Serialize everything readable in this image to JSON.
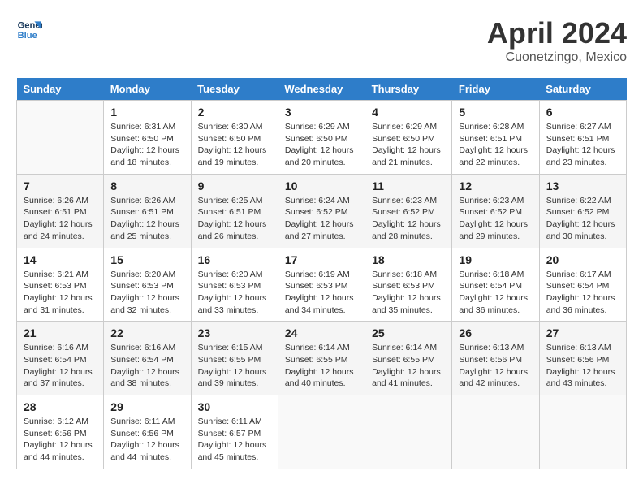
{
  "header": {
    "logo_line1": "General",
    "logo_line2": "Blue",
    "month": "April 2024",
    "location": "Cuonetzingo, Mexico"
  },
  "columns": [
    "Sunday",
    "Monday",
    "Tuesday",
    "Wednesday",
    "Thursday",
    "Friday",
    "Saturday"
  ],
  "weeks": [
    [
      {
        "day": "",
        "empty": true
      },
      {
        "day": "1",
        "sunrise": "Sunrise: 6:31 AM",
        "sunset": "Sunset: 6:50 PM",
        "daylight": "Daylight: 12 hours and 18 minutes."
      },
      {
        "day": "2",
        "sunrise": "Sunrise: 6:30 AM",
        "sunset": "Sunset: 6:50 PM",
        "daylight": "Daylight: 12 hours and 19 minutes."
      },
      {
        "day": "3",
        "sunrise": "Sunrise: 6:29 AM",
        "sunset": "Sunset: 6:50 PM",
        "daylight": "Daylight: 12 hours and 20 minutes."
      },
      {
        "day": "4",
        "sunrise": "Sunrise: 6:29 AM",
        "sunset": "Sunset: 6:50 PM",
        "daylight": "Daylight: 12 hours and 21 minutes."
      },
      {
        "day": "5",
        "sunrise": "Sunrise: 6:28 AM",
        "sunset": "Sunset: 6:51 PM",
        "daylight": "Daylight: 12 hours and 22 minutes."
      },
      {
        "day": "6",
        "sunrise": "Sunrise: 6:27 AM",
        "sunset": "Sunset: 6:51 PM",
        "daylight": "Daylight: 12 hours and 23 minutes."
      }
    ],
    [
      {
        "day": "7",
        "sunrise": "Sunrise: 6:26 AM",
        "sunset": "Sunset: 6:51 PM",
        "daylight": "Daylight: 12 hours and 24 minutes."
      },
      {
        "day": "8",
        "sunrise": "Sunrise: 6:26 AM",
        "sunset": "Sunset: 6:51 PM",
        "daylight": "Daylight: 12 hours and 25 minutes."
      },
      {
        "day": "9",
        "sunrise": "Sunrise: 6:25 AM",
        "sunset": "Sunset: 6:51 PM",
        "daylight": "Daylight: 12 hours and 26 minutes."
      },
      {
        "day": "10",
        "sunrise": "Sunrise: 6:24 AM",
        "sunset": "Sunset: 6:52 PM",
        "daylight": "Daylight: 12 hours and 27 minutes."
      },
      {
        "day": "11",
        "sunrise": "Sunrise: 6:23 AM",
        "sunset": "Sunset: 6:52 PM",
        "daylight": "Daylight: 12 hours and 28 minutes."
      },
      {
        "day": "12",
        "sunrise": "Sunrise: 6:23 AM",
        "sunset": "Sunset: 6:52 PM",
        "daylight": "Daylight: 12 hours and 29 minutes."
      },
      {
        "day": "13",
        "sunrise": "Sunrise: 6:22 AM",
        "sunset": "Sunset: 6:52 PM",
        "daylight": "Daylight: 12 hours and 30 minutes."
      }
    ],
    [
      {
        "day": "14",
        "sunrise": "Sunrise: 6:21 AM",
        "sunset": "Sunset: 6:53 PM",
        "daylight": "Daylight: 12 hours and 31 minutes."
      },
      {
        "day": "15",
        "sunrise": "Sunrise: 6:20 AM",
        "sunset": "Sunset: 6:53 PM",
        "daylight": "Daylight: 12 hours and 32 minutes."
      },
      {
        "day": "16",
        "sunrise": "Sunrise: 6:20 AM",
        "sunset": "Sunset: 6:53 PM",
        "daylight": "Daylight: 12 hours and 33 minutes."
      },
      {
        "day": "17",
        "sunrise": "Sunrise: 6:19 AM",
        "sunset": "Sunset: 6:53 PM",
        "daylight": "Daylight: 12 hours and 34 minutes."
      },
      {
        "day": "18",
        "sunrise": "Sunrise: 6:18 AM",
        "sunset": "Sunset: 6:53 PM",
        "daylight": "Daylight: 12 hours and 35 minutes."
      },
      {
        "day": "19",
        "sunrise": "Sunrise: 6:18 AM",
        "sunset": "Sunset: 6:54 PM",
        "daylight": "Daylight: 12 hours and 36 minutes."
      },
      {
        "day": "20",
        "sunrise": "Sunrise: 6:17 AM",
        "sunset": "Sunset: 6:54 PM",
        "daylight": "Daylight: 12 hours and 36 minutes."
      }
    ],
    [
      {
        "day": "21",
        "sunrise": "Sunrise: 6:16 AM",
        "sunset": "Sunset: 6:54 PM",
        "daylight": "Daylight: 12 hours and 37 minutes."
      },
      {
        "day": "22",
        "sunrise": "Sunrise: 6:16 AM",
        "sunset": "Sunset: 6:54 PM",
        "daylight": "Daylight: 12 hours and 38 minutes."
      },
      {
        "day": "23",
        "sunrise": "Sunrise: 6:15 AM",
        "sunset": "Sunset: 6:55 PM",
        "daylight": "Daylight: 12 hours and 39 minutes."
      },
      {
        "day": "24",
        "sunrise": "Sunrise: 6:14 AM",
        "sunset": "Sunset: 6:55 PM",
        "daylight": "Daylight: 12 hours and 40 minutes."
      },
      {
        "day": "25",
        "sunrise": "Sunrise: 6:14 AM",
        "sunset": "Sunset: 6:55 PM",
        "daylight": "Daylight: 12 hours and 41 minutes."
      },
      {
        "day": "26",
        "sunrise": "Sunrise: 6:13 AM",
        "sunset": "Sunset: 6:56 PM",
        "daylight": "Daylight: 12 hours and 42 minutes."
      },
      {
        "day": "27",
        "sunrise": "Sunrise: 6:13 AM",
        "sunset": "Sunset: 6:56 PM",
        "daylight": "Daylight: 12 hours and 43 minutes."
      }
    ],
    [
      {
        "day": "28",
        "sunrise": "Sunrise: 6:12 AM",
        "sunset": "Sunset: 6:56 PM",
        "daylight": "Daylight: 12 hours and 44 minutes."
      },
      {
        "day": "29",
        "sunrise": "Sunrise: 6:11 AM",
        "sunset": "Sunset: 6:56 PM",
        "daylight": "Daylight: 12 hours and 44 minutes."
      },
      {
        "day": "30",
        "sunrise": "Sunrise: 6:11 AM",
        "sunset": "Sunset: 6:57 PM",
        "daylight": "Daylight: 12 hours and 45 minutes."
      },
      {
        "day": "",
        "empty": true
      },
      {
        "day": "",
        "empty": true
      },
      {
        "day": "",
        "empty": true
      },
      {
        "day": "",
        "empty": true
      }
    ]
  ]
}
